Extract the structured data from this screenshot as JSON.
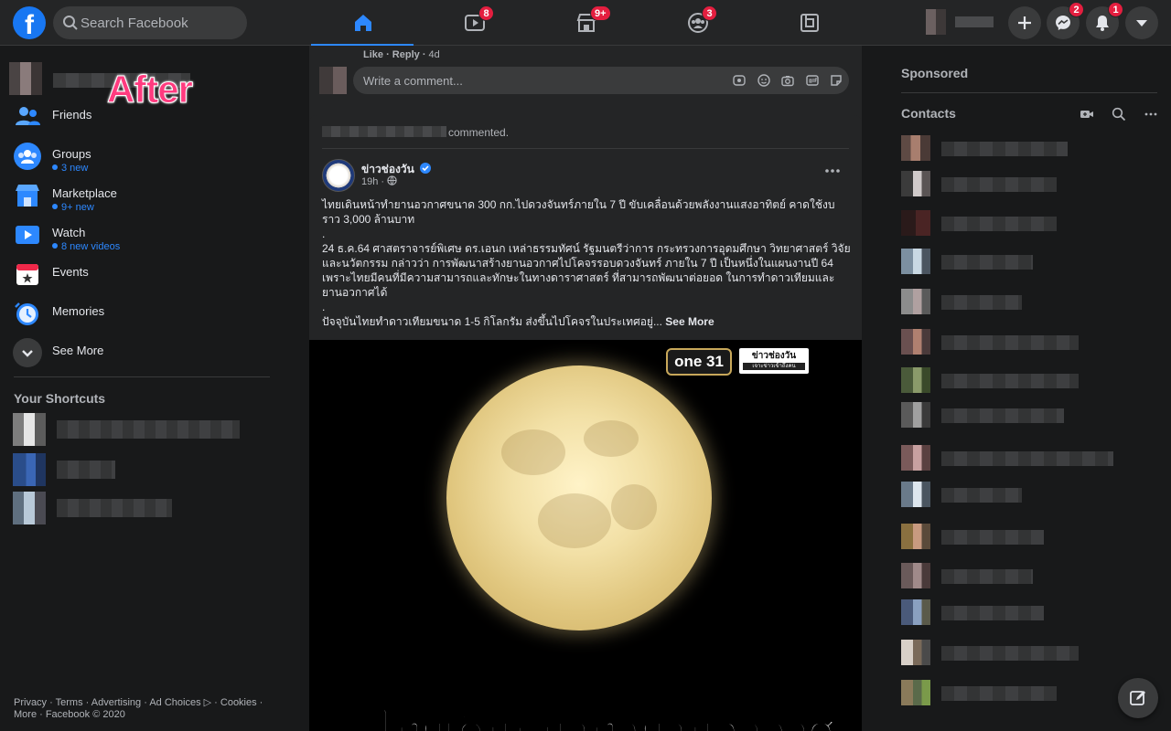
{
  "header": {
    "logo": "f",
    "search_placeholder": "Search Facebook",
    "tabs": [
      {
        "name": "home",
        "icon": "home-icon",
        "badge": "",
        "active": true
      },
      {
        "name": "watch",
        "icon": "video-icon",
        "badge": "8"
      },
      {
        "name": "marketplace",
        "icon": "marketplace-icon",
        "badge": "9+"
      },
      {
        "name": "groups",
        "icon": "groups-icon",
        "badge": "3"
      },
      {
        "name": "gaming",
        "icon": "gaming-icon",
        "badge": ""
      }
    ],
    "messenger_badge": "2",
    "notifications_badge": "1"
  },
  "overlay_label": "After",
  "sidebar": {
    "items": [
      {
        "label": "Friends",
        "sub": ""
      },
      {
        "label": "Groups",
        "sub": "3 new"
      },
      {
        "label": "Marketplace",
        "sub": "9+ new"
      },
      {
        "label": "Watch",
        "sub": "8 new videos"
      },
      {
        "label": "Events",
        "sub": ""
      },
      {
        "label": "Memories",
        "sub": ""
      },
      {
        "label": "See More",
        "sub": ""
      }
    ],
    "shortcuts_title": "Your Shortcuts",
    "footer": "Privacy · Terms · Advertising · Ad Choices ▷ · Cookies · More · Facebook © 2020"
  },
  "feed": {
    "like_label": "Like",
    "reply_label": "Reply",
    "comment_time": "4d",
    "comment_placeholder": "Write a comment...",
    "post": {
      "activity_suffix": "commented.",
      "page_name": "ข่าวช่องวัน",
      "time": "19h",
      "text_lines": [
        "ไทยเดินหน้าทำยานอวกาศขนาด 300 กก.ไปดวงจันทร์ภายใน 7 ปี ขับเคลื่อนด้วยพลังงานแสงอาทิตย์ คาดใช้งบราว 3,000 ล้านบาท",
        ".",
        "24 ธ.ค.64  ศาสตราจารย์พิเศษ ดร.เอนก เหล่าธรรมทัศน์ รัฐมนตรีว่าการ กระทรวงการอุดมศึกษา วิทยาศาสตร์ วิจัยและนวัตกรรม กล่าวว่า การพัฒนาสร้างยานอวกาศไปโคจรรอบดวงจันทร์ ภายใน 7 ปี  เป็นหนึ่งในแผนงานปี 64 เพราะไทยมีคนที่มีความสามารถและทักษะในทางดาราศาสตร์ ที่สามารถพัฒนาต่อยอด ในการทำดาวเทียมและยานอวกาศได้",
        ".",
        "ปัจจุบันไทยทำดาวเทียมขนาด 1-5 กิโลกรัม ส่งขึ้นไปโคจรในประเทศอยู่..."
      ],
      "see_more": "See More",
      "image_logo_1": "one 31",
      "image_logo_2": "ข่าวช่องวัน",
      "image_logo_2_tag": "เจาะข่าวเข้าถึงคน",
      "image_headline": "ไทยเดินหน้าทำยานอวกาศ"
    }
  },
  "right": {
    "sponsored_title": "Sponsored",
    "contacts_title": "Contacts"
  },
  "colors": {
    "accent": "#2d88ff",
    "badge": "#e41e3f",
    "background": "#18191a",
    "surface": "#242526"
  }
}
